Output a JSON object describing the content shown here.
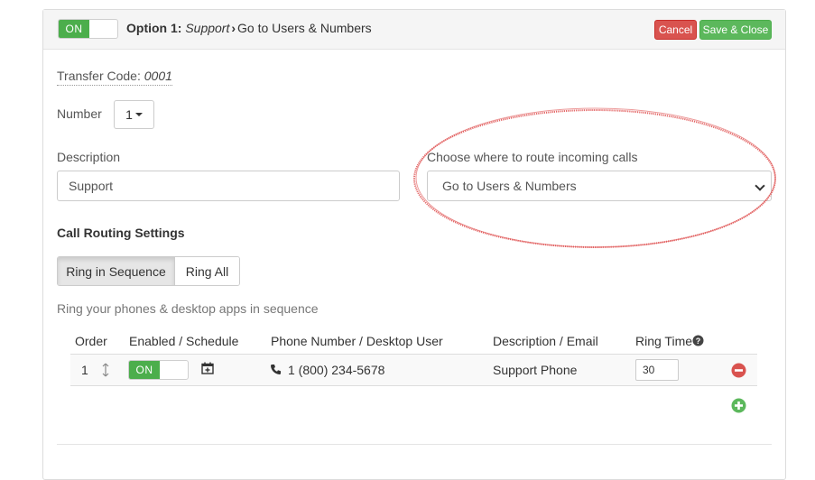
{
  "header": {
    "toggle_label": "ON",
    "title_prefix": "Option 1:",
    "title_name": "Support",
    "title_arrow": "›",
    "title_destination": "Go to Users & Numbers",
    "cancel_label": "Cancel",
    "save_label": "Save & Close"
  },
  "form": {
    "transfer_code_label": "Transfer Code:",
    "transfer_code_value": "0001",
    "number_label": "Number",
    "number_value": "1",
    "description_label": "Description",
    "description_value": "Support",
    "route_label": "Choose where to route incoming calls",
    "route_value": "Go to Users & Numbers"
  },
  "routing": {
    "section_title": "Call Routing Settings",
    "mode_active": "Ring in Sequence",
    "mode_other": "Ring All",
    "help_text": "Ring your phones & desktop apps in sequence"
  },
  "table": {
    "headers": {
      "order": "Order",
      "enabled": "Enabled / Schedule",
      "phone": "Phone Number / Desktop User",
      "description": "Description / Email",
      "ring_time": "Ring Time"
    },
    "rows": [
      {
        "order": "1",
        "enabled": "ON",
        "phone": "1 (800) 234-5678",
        "description": "Support Phone",
        "ring_time": "30"
      }
    ]
  },
  "colors": {
    "success": "#5cb85c",
    "danger": "#d9534f",
    "annotation": "#e05555"
  },
  "icons": [
    "sort-icon",
    "calendar-add-icon",
    "phone-icon",
    "help-circle-icon",
    "remove-circle-icon",
    "add-circle-icon"
  ]
}
